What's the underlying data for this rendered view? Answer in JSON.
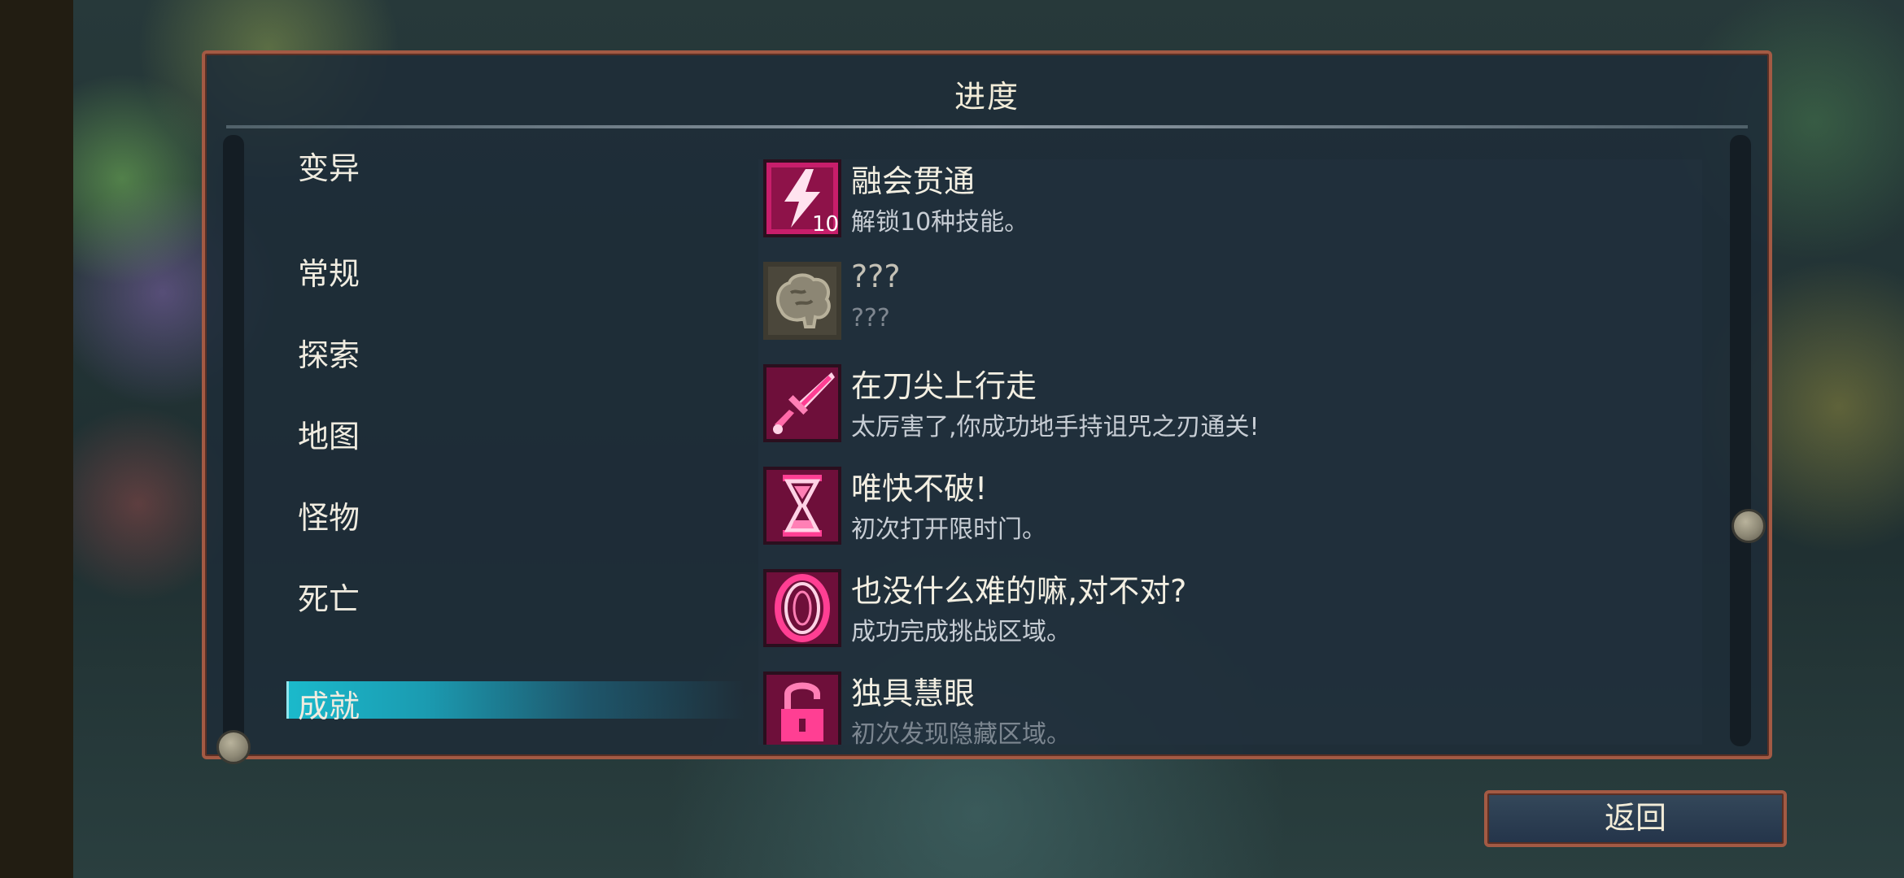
{
  "panel": {
    "title": "进度"
  },
  "categories": [
    {
      "label": "变异"
    },
    {
      "label": "常规"
    },
    {
      "label": "探索"
    },
    {
      "label": "地图"
    },
    {
      "label": "怪物"
    },
    {
      "label": "死亡"
    },
    {
      "label": "成就",
      "selected": true
    }
  ],
  "achievements": [
    {
      "title": "融会贯通",
      "desc": "解锁10种技能。",
      "icon": "lightning-10-icon",
      "badge": "10",
      "locked": false
    },
    {
      "title": "???",
      "desc": "???",
      "icon": "brain-icon",
      "locked": true
    },
    {
      "title": "在刀尖上行走",
      "desc": "太厉害了,你成功地手持诅咒之刃通关!",
      "icon": "cursed-sword-icon",
      "locked": false
    },
    {
      "title": "唯快不破!",
      "desc": "初次打开限时门。",
      "icon": "hourglass-icon",
      "locked": false
    },
    {
      "title": "也没什么难的嘛,对不对?",
      "desc": "成功完成挑战区域。",
      "icon": "portal-ring-icon",
      "locked": false
    },
    {
      "title": "独具慧眼",
      "desc": "初次发现隐藏区域。",
      "icon": "padlock-icon",
      "locked": false
    }
  ],
  "back_button": {
    "label": "返回"
  },
  "colors": {
    "accent_pink": "#ff2e8a",
    "selected_cyan": "#1bb9cb",
    "border_copper": "#a35a44"
  }
}
